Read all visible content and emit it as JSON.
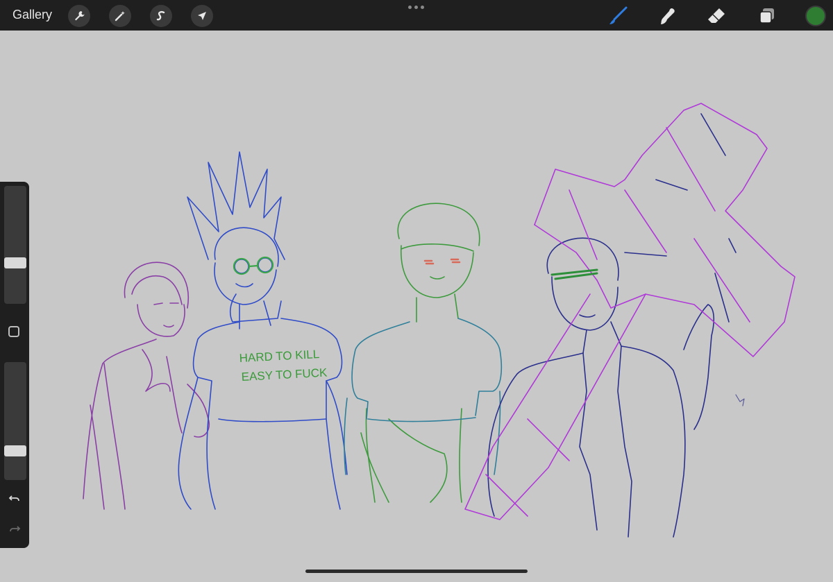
{
  "topbar": {
    "gallery_label": "Gallery",
    "left_tools": [
      "wrench-icon",
      "magic-wand-icon",
      "selection-s-icon",
      "arrow-cursor-icon"
    ],
    "right_tools": [
      "brush-icon",
      "smudge-icon",
      "eraser-icon",
      "layers-icon"
    ],
    "active_tool": "brush-icon",
    "current_color": "#2e7d32"
  },
  "sidebar": {
    "brush_size_level": 0.33,
    "opacity_level": 0.22,
    "buttons": [
      "modify-button",
      "undo-button",
      "redo-button"
    ]
  },
  "canvas": {
    "background": "#c8c8c8",
    "shirt_text_line1": "HARD TO KILL",
    "shirt_text_line2": "EASY TO FUCK"
  }
}
